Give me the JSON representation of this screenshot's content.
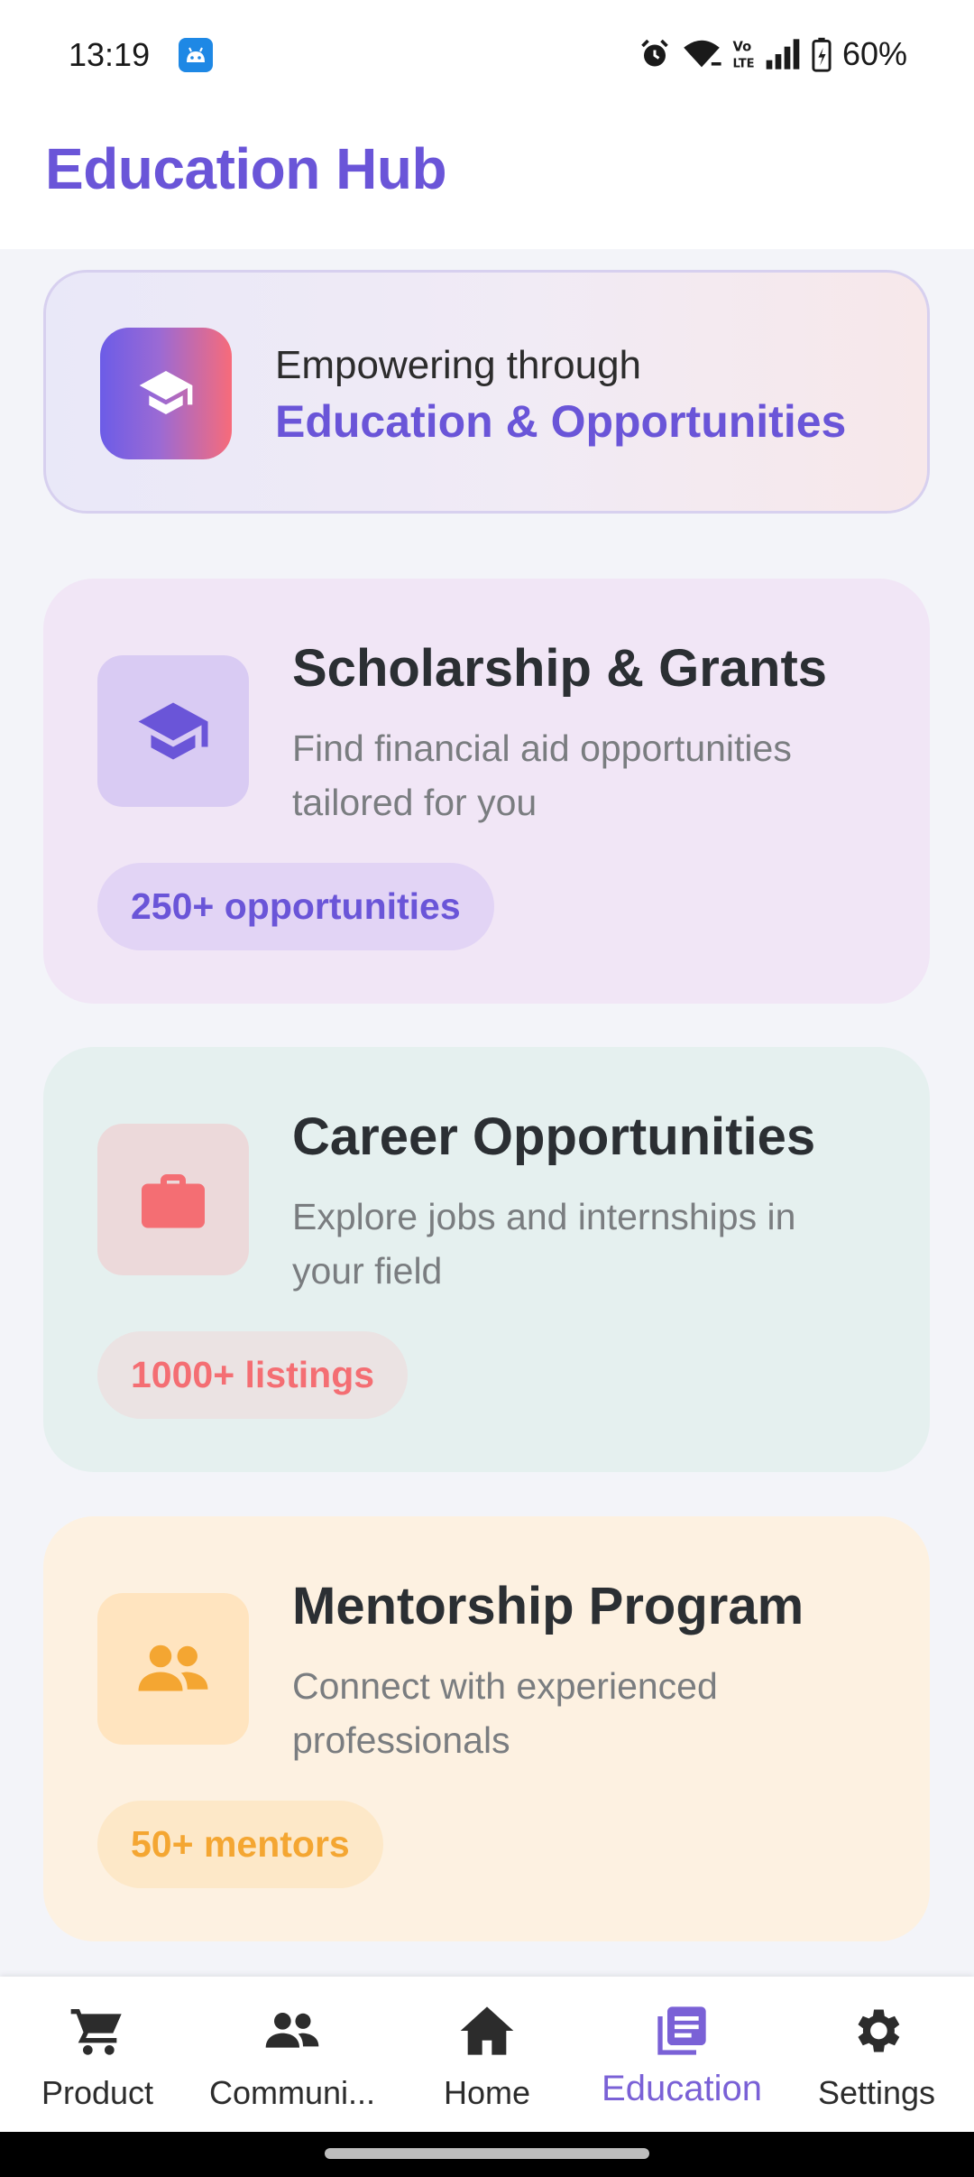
{
  "status_bar": {
    "time": "13:19",
    "battery": "60%",
    "icons": [
      "android-debug-icon",
      "alarm-icon",
      "wifi-icon",
      "volte-icon",
      "signal-icon",
      "battery-icon"
    ]
  },
  "app_bar": {
    "title": "Education Hub"
  },
  "banner": {
    "icon": "graduation-cap-icon",
    "line1": "Empowering through",
    "line2": "Education & Opportunities"
  },
  "cards": [
    {
      "icon": "graduation-cap-icon",
      "title": "Scholarship & Grants",
      "description": "Find financial aid opportunities tailored for you",
      "chip": "250+ opportunities",
      "accent": "#6a55d8"
    },
    {
      "icon": "briefcase-icon",
      "title": "Career Opportunities",
      "description": "Explore jobs and internships in your field",
      "chip": "1000+ listings",
      "accent": "#f46e73"
    },
    {
      "icon": "people-icon",
      "title": "Mentorship Program",
      "description": "Connect with experienced professionals",
      "chip": "50+ mentors",
      "accent": "#f4a632"
    }
  ],
  "bottom_nav": {
    "items": [
      {
        "label": "Product",
        "icon": "cart-icon",
        "active": false
      },
      {
        "label": "Communi...",
        "icon": "people-icon",
        "active": false
      },
      {
        "label": "Home",
        "icon": "home-icon",
        "active": false
      },
      {
        "label": "Education",
        "icon": "library-books-icon",
        "active": true
      },
      {
        "label": "Settings",
        "icon": "gear-icon",
        "active": false
      }
    ],
    "active_color": "#7a61d6"
  }
}
